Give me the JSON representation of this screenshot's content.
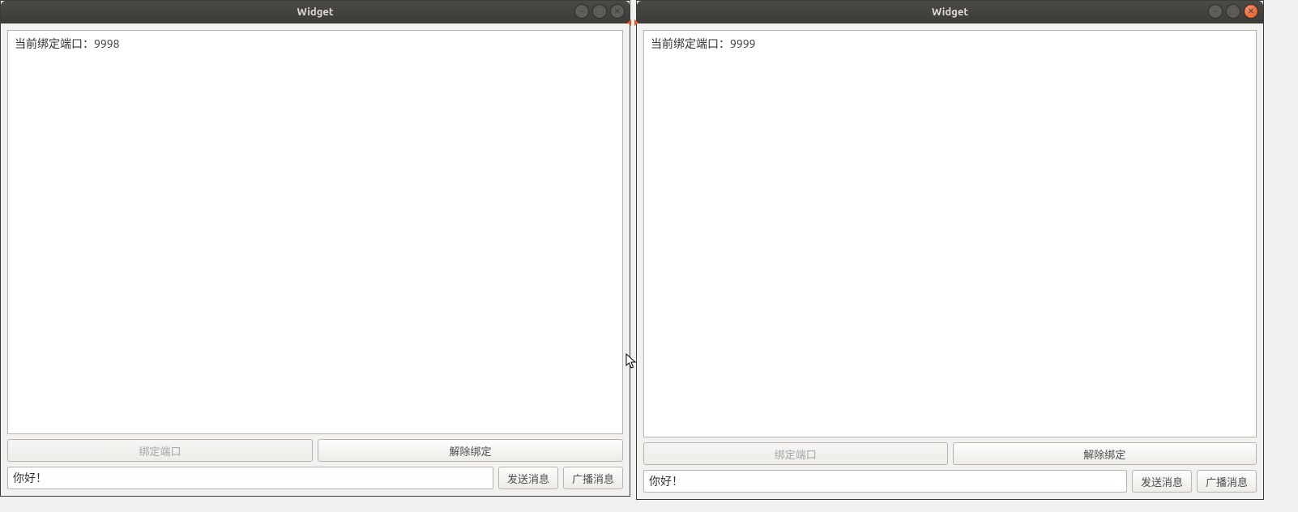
{
  "windows": [
    {
      "title": "Widget",
      "close_style": "dark",
      "text_display": "当前绑定端口：9998",
      "bind_button_label": "绑定端口",
      "bind_button_disabled": true,
      "unbind_button_label": "解除绑定",
      "input_value": "你好！",
      "send_button_label": "发送消息",
      "broadcast_button_label": "广播消息"
    },
    {
      "title": "Widget",
      "close_style": "orange",
      "text_display": "当前绑定端口：9999",
      "bind_button_label": "绑定端口",
      "bind_button_disabled": true,
      "unbind_button_label": "解除绑定",
      "input_value": "你好！",
      "send_button_label": "发送消息",
      "broadcast_button_label": "广播消息"
    }
  ]
}
